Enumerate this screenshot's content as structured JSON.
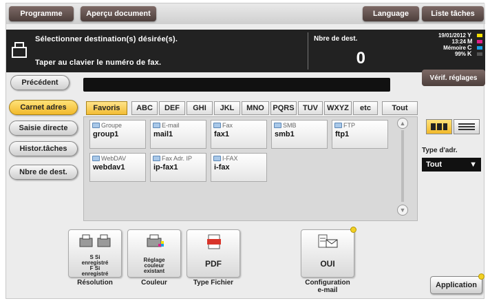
{
  "topbar": {
    "programme": "Programme",
    "apercu": "Aperçu document",
    "language": "Language",
    "liste_taches": "Liste tâches"
  },
  "header": {
    "line1": "Sélectionner destination(s) désirée(s).",
    "line2": "Taper au clavier le numéro de fax.",
    "count_label": "Nbre de dest.",
    "count_value": "0",
    "date": "19/01/2012",
    "time": "13:24",
    "memory_label": "Mémoire",
    "memory_value": "99%",
    "ink_letters": [
      "Y",
      "M",
      "C",
      "K"
    ],
    "ink_colors": [
      "#f5e000",
      "#e0208a",
      "#1aa0e6",
      "#222222"
    ]
  },
  "nav": {
    "precedent": "Précédent",
    "verif": "Vérif. réglages",
    "side": [
      "Carnet adres",
      "Saisie directe",
      "Histor.tâches",
      "Nbre de dest."
    ],
    "active_side": 0
  },
  "index_tabs": [
    "Favoris",
    "ABC",
    "DEF",
    "GHI",
    "JKL",
    "MNO",
    "PQRS",
    "TUV",
    "WXYZ",
    "etc",
    "Tout"
  ],
  "destinations": [
    {
      "type": "Groupe",
      "name": "group1",
      "icon": "group-icon"
    },
    {
      "type": "E-mail",
      "name": "mail1",
      "icon": "email-icon"
    },
    {
      "type": "Fax",
      "name": "fax1",
      "icon": "fax-icon"
    },
    {
      "type": "SMB",
      "name": "smb1",
      "icon": "smb-icon"
    },
    {
      "type": "FTP",
      "name": "ftp1",
      "icon": "ftp-icon"
    },
    {
      "type": "WebDAV",
      "name": "webdav1",
      "icon": "webdav-icon"
    },
    {
      "type": "Fax Adr. IP",
      "name": "ip-fax1",
      "icon": "ip-fax-icon"
    },
    {
      "type": "I-FAX",
      "name": "i-fax",
      "icon": "i-fax-icon"
    }
  ],
  "type_adr": {
    "label": "Type d'adr.",
    "value": "Tout"
  },
  "functions": {
    "resolution": {
      "caption": "Résolution",
      "l1": "S Si",
      "l2": "enregistré",
      "l3": "F Si",
      "l4": "enregistré"
    },
    "couleur": {
      "caption": "Couleur",
      "l1": "Réglage",
      "l2": "couleur",
      "l3": "existant"
    },
    "type_fichier": {
      "caption": "Type Fichier",
      "value": "PDF"
    },
    "config_email": {
      "caption1": "Configuration",
      "caption2": "e-mail",
      "value": "OUI"
    }
  },
  "application": "Application"
}
